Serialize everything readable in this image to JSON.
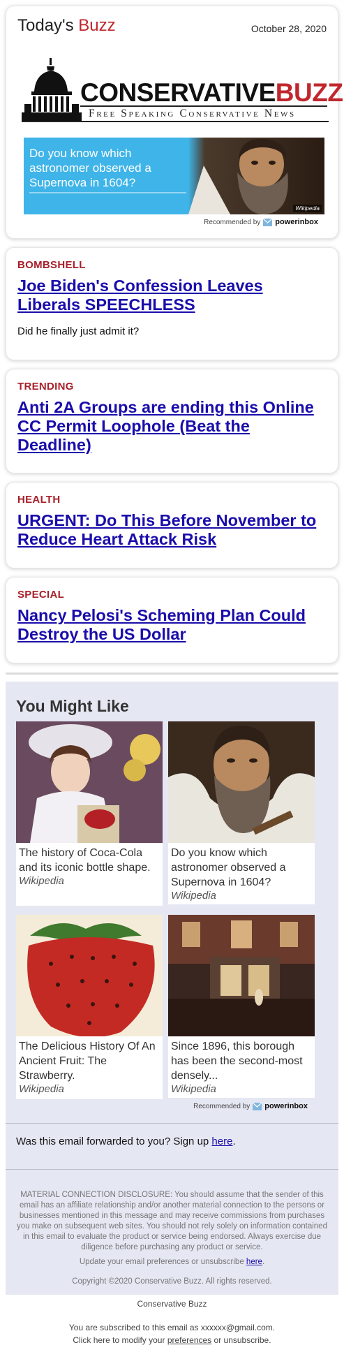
{
  "header": {
    "brand_prefix": "Today's ",
    "brand_accent": "Buzz",
    "date": "October 28, 2020",
    "logo": {
      "word1": "CONSERVATIVE",
      "word2": "BUZZ",
      "tagline": "Free Speaking Conservative News"
    },
    "ad": {
      "text": "Do you know which astronomer observed a Supernova in 1604?",
      "source": "Wikipedia",
      "recommended_prefix": "Recommended by",
      "recommended_brand": "powerinbox"
    }
  },
  "stories": [
    {
      "category": "BOMBSHELL",
      "title": "Joe Biden's Confession Leaves Liberals SPEECHLESS",
      "subtitle": "Did he finally just admit it?"
    },
    {
      "category": "TRENDING",
      "title": "Anti 2A Groups are ending this Online CC Permit Loophole (Beat the Deadline)"
    },
    {
      "category": "HEALTH",
      "title": "URGENT: Do This Before November to Reduce Heart Attack Risk"
    },
    {
      "category": "SPECIAL",
      "title": "Nancy Pelosi's Scheming Plan Could Destroy the US Dollar"
    }
  ],
  "you_might_like": {
    "title": "You Might Like",
    "tiles": [
      {
        "text": "The history of Coca-Cola and its iconic bottle shape.",
        "source": "Wikipedia"
      },
      {
        "text": "Do you know which astronomer observed a Supernova in 1604?",
        "source": "Wikipedia"
      },
      {
        "text": "The Delicious History Of An Ancient Fruit: The Strawberry.",
        "source": "Wikipedia"
      },
      {
        "text": "Since 1896, this borough has been the second-most densely...",
        "source": "Wikipedia"
      }
    ],
    "recommended_prefix": "Recommended by",
    "recommended_brand": "powerinbox"
  },
  "forward": {
    "text": "Was this email forwarded to you? Sign up ",
    "link": "here",
    "suffix": "."
  },
  "disclosure": "MATERIAL CONNECTION DISCLOSURE: You should assume that the sender of this email has an affiliate relationship and/or another material connection to the persons or businesses mentioned in this message and may receive commissions from purchases you make on subsequent web sites. You should not rely solely on information contained in this email to evaluate the product or service being endorsed. Always exercise due diligence before purchasing any product or service.",
  "preferences": {
    "text": "Update your email preferences or unsubscribe ",
    "link": "here",
    "suffix": "."
  },
  "copyright": "Copyright ©2020 Conservative Buzz. All rights reserved.",
  "footer": {
    "name": "Conservative Buzz",
    "subscribed": "You are subscribed to this email as xxxxxx@gmail.com.",
    "modify_prefix": "Click here to modify your ",
    "modify_link": "preferences",
    "modify_suffix": " or unsubscribe."
  },
  "colors": {
    "accent_red": "#c0272d",
    "category_red": "#a8202a",
    "link_blue": "#1a0dab",
    "ad_blue": "#3fb4e8",
    "panel_lavender": "#e5e7f3"
  }
}
